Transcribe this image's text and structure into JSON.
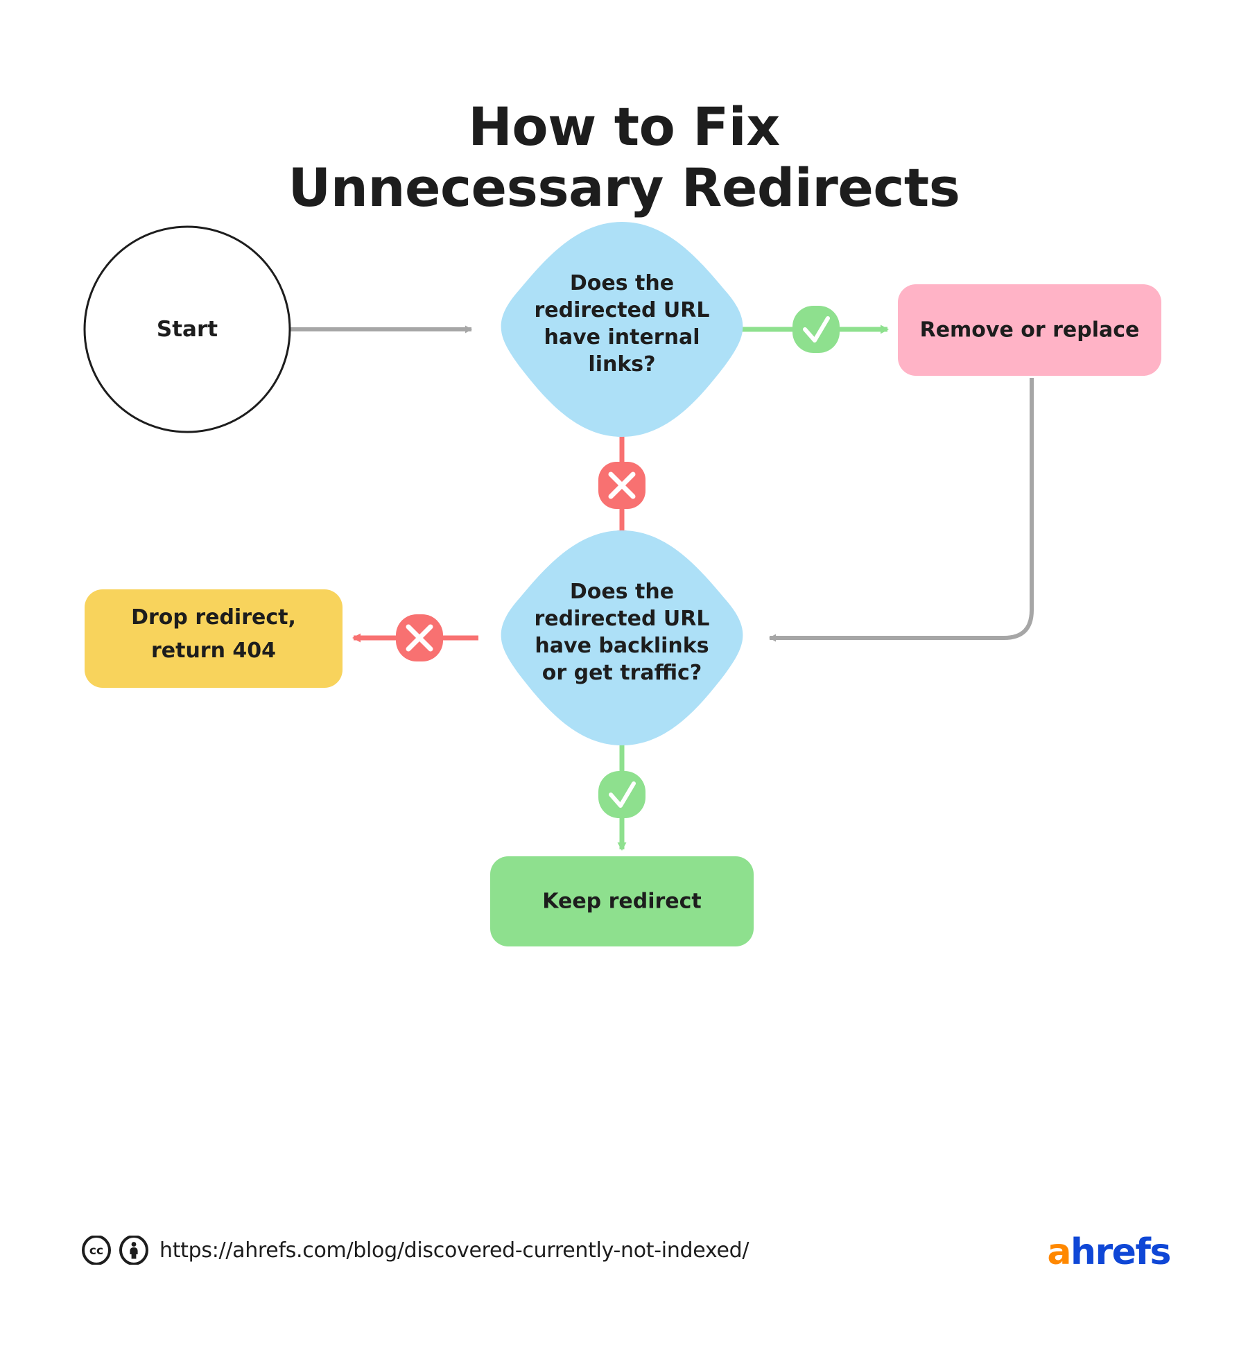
{
  "title": {
    "line1": "How to Fix",
    "line2": "Unnecessary Redirects"
  },
  "nodes": {
    "start": {
      "label": "Start",
      "shape": "circle",
      "fill": "#ffffff",
      "stroke": "#1d1d1d"
    },
    "decision1": {
      "label_lines": [
        "Does the",
        "redirected URL",
        "have internal",
        "links?"
      ],
      "shape": "rounded-diamond",
      "fill": "#ade0f7"
    },
    "remove_or_replace": {
      "label": "Remove or replace",
      "shape": "rounded-rect",
      "fill": "#ffb3c6"
    },
    "decision2": {
      "label_lines": [
        "Does the",
        "redirected URL",
        "have backlinks",
        "or get traffic?"
      ],
      "shape": "rounded-diamond",
      "fill": "#ade0f7"
    },
    "drop_redirect": {
      "label_lines": [
        "Drop redirect,",
        "return 404"
      ],
      "shape": "rounded-rect",
      "fill": "#f8d35c"
    },
    "keep_redirect": {
      "label": "Keep redirect",
      "shape": "rounded-rect",
      "fill": "#8ee08e"
    }
  },
  "edges": [
    {
      "from": "start",
      "to": "decision1",
      "color": "#a6a6a6",
      "badge": "none"
    },
    {
      "from": "decision1",
      "to": "remove_or_replace",
      "color": "#8ee08e",
      "badge": "check"
    },
    {
      "from": "decision1",
      "to": "decision2",
      "color": "#f87171",
      "badge": "cross"
    },
    {
      "from": "remove_or_replace",
      "to": "decision2",
      "color": "#a6a6a6",
      "badge": "none"
    },
    {
      "from": "decision2",
      "to": "drop_redirect",
      "color": "#f87171",
      "badge": "cross"
    },
    {
      "from": "decision2",
      "to": "keep_redirect",
      "color": "#8ee08e",
      "badge": "check"
    }
  ],
  "badges": {
    "check": {
      "icon": "check-icon",
      "fill": "#8ee08e",
      "glyph": "✓"
    },
    "cross": {
      "icon": "cross-icon",
      "fill": "#f87171",
      "glyph": "✕"
    }
  },
  "colors": {
    "blue": "#ade0f7",
    "pink": "#ffb3c6",
    "yellow": "#f8d35c",
    "green": "#8ee08e",
    "red": "#f87171",
    "gray": "#a6a6a6",
    "text": "#1d1d1d",
    "brand_orange": "#ff8800",
    "brand_blue": "#0f47d6"
  },
  "footer": {
    "license_icons": [
      "cc-icon",
      "cc-by-person-icon"
    ],
    "url": "https://ahrefs.com/blog/discovered-currently-not-indexed/",
    "brand_a": "a",
    "brand_rest": "hrefs"
  }
}
